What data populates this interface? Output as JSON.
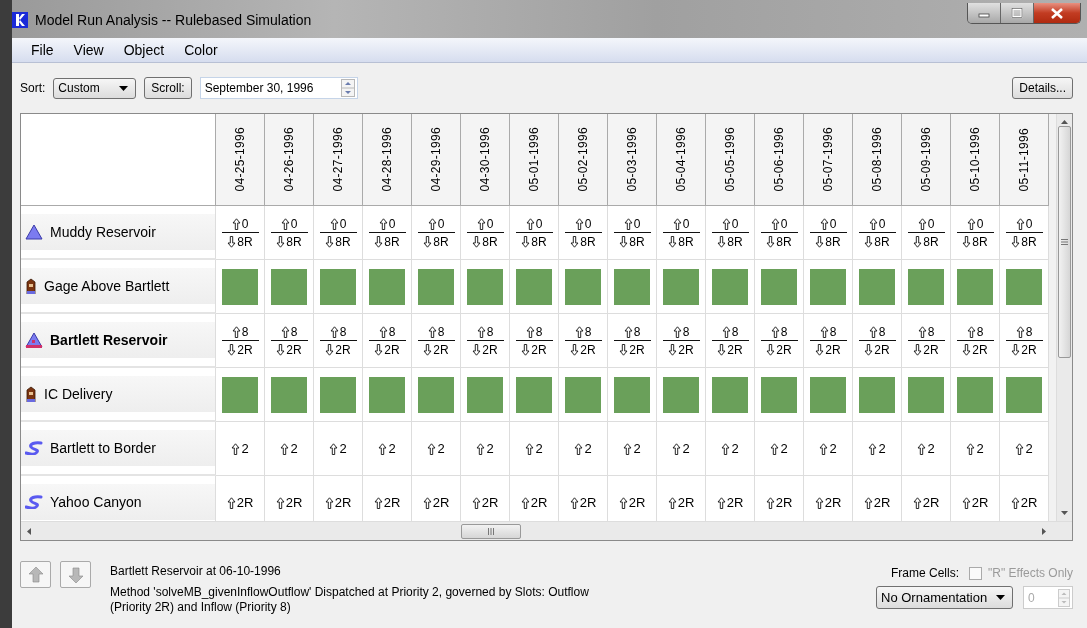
{
  "window": {
    "title": "Model Run Analysis -- Rulebased Simulation"
  },
  "menu": [
    "File",
    "View",
    "Object",
    "Color"
  ],
  "toolbar": {
    "sort_label": "Sort:",
    "sort_value": "Custom",
    "scroll_button": "Scroll:",
    "date": "September 30, 1996",
    "details_button": "Details..."
  },
  "table": {
    "columns": [
      "04-25-1996",
      "04-26-1996",
      "04-27-1996",
      "04-28-1996",
      "04-29-1996",
      "04-30-1996",
      "05-01-1996",
      "05-02-1996",
      "05-03-1996",
      "05-04-1996",
      "05-05-1996",
      "05-06-1996",
      "05-07-1996",
      "05-08-1996",
      "05-09-1996",
      "05-10-1996",
      "05-11-1996"
    ],
    "rows": [
      {
        "name": "Muddy Reservoir",
        "kind": "reservoir",
        "selected": false,
        "cells": [
          {
            "up": "0",
            "down": "8R"
          },
          {
            "up": "0",
            "down": "8R"
          },
          {
            "up": "0",
            "down": "8R"
          },
          {
            "up": "0",
            "down": "8R"
          },
          {
            "up": "0",
            "down": "8R"
          },
          {
            "up": "0",
            "down": "8R"
          },
          {
            "up": "0",
            "down": "8R"
          },
          {
            "up": "0",
            "down": "8R"
          },
          {
            "up": "0",
            "down": "8R"
          },
          {
            "up": "0",
            "down": "8R"
          },
          {
            "up": "0",
            "down": "8R"
          },
          {
            "up": "0",
            "down": "8R"
          },
          {
            "up": "0",
            "down": "8R"
          },
          {
            "up": "0",
            "down": "8R"
          },
          {
            "up": "0",
            "down": "8R"
          },
          {
            "up": "0",
            "down": "8R"
          },
          {
            "up": "0",
            "down": "8R"
          }
        ]
      },
      {
        "name": "Gage Above Bartlett",
        "kind": "gage",
        "selected": false,
        "cells": [
          {
            "filled": true
          },
          {
            "filled": true
          },
          {
            "filled": true
          },
          {
            "filled": true
          },
          {
            "filled": true
          },
          {
            "filled": true
          },
          {
            "filled": true
          },
          {
            "filled": true
          },
          {
            "filled": true
          },
          {
            "filled": true
          },
          {
            "filled": true
          },
          {
            "filled": true
          },
          {
            "filled": true
          },
          {
            "filled": true
          },
          {
            "filled": true
          },
          {
            "filled": true
          },
          {
            "filled": true
          }
        ]
      },
      {
        "name": "Bartlett Reservoir",
        "kind": "reservoir",
        "selected": true,
        "cells": [
          {
            "up": "8",
            "down": "2R"
          },
          {
            "up": "8",
            "down": "2R"
          },
          {
            "up": "8",
            "down": "2R"
          },
          {
            "up": "8",
            "down": "2R"
          },
          {
            "up": "8",
            "down": "2R"
          },
          {
            "up": "8",
            "down": "2R"
          },
          {
            "up": "8",
            "down": "2R"
          },
          {
            "up": "8",
            "down": "2R"
          },
          {
            "up": "8",
            "down": "2R"
          },
          {
            "up": "8",
            "down": "2R"
          },
          {
            "up": "8",
            "down": "2R"
          },
          {
            "up": "8",
            "down": "2R"
          },
          {
            "up": "8",
            "down": "2R"
          },
          {
            "up": "8",
            "down": "2R"
          },
          {
            "up": "8",
            "down": "2R"
          },
          {
            "up": "8",
            "down": "2R"
          },
          {
            "up": "8",
            "down": "2R"
          }
        ]
      },
      {
        "name": "IC Delivery",
        "kind": "gage",
        "selected": false,
        "cells": [
          {
            "filled": true
          },
          {
            "filled": true
          },
          {
            "filled": true
          },
          {
            "filled": true
          },
          {
            "filled": true
          },
          {
            "filled": true
          },
          {
            "filled": true
          },
          {
            "filled": true
          },
          {
            "filled": true
          },
          {
            "filled": true
          },
          {
            "filled": true
          },
          {
            "filled": true
          },
          {
            "filled": true
          },
          {
            "filled": true
          },
          {
            "filled": true
          },
          {
            "filled": true
          },
          {
            "filled": true
          }
        ]
      },
      {
        "name": "Bartlett to Border",
        "kind": "reach",
        "selected": false,
        "cells": [
          {
            "up": "2"
          },
          {
            "up": "2"
          },
          {
            "up": "2"
          },
          {
            "up": "2"
          },
          {
            "up": "2"
          },
          {
            "up": "2"
          },
          {
            "up": "2"
          },
          {
            "up": "2"
          },
          {
            "up": "2"
          },
          {
            "up": "2"
          },
          {
            "up": "2"
          },
          {
            "up": "2"
          },
          {
            "up": "2"
          },
          {
            "up": "2"
          },
          {
            "up": "2"
          },
          {
            "up": "2"
          },
          {
            "up": "2"
          }
        ]
      },
      {
        "name": "Yahoo Canyon",
        "kind": "reach",
        "selected": false,
        "cells": [
          {
            "up": "2R"
          },
          {
            "up": "2R"
          },
          {
            "up": "2R"
          },
          {
            "up": "2R"
          },
          {
            "up": "2R"
          },
          {
            "up": "2R"
          },
          {
            "up": "2R"
          },
          {
            "up": "2R"
          },
          {
            "up": "2R"
          },
          {
            "up": "2R"
          },
          {
            "up": "2R"
          },
          {
            "up": "2R"
          },
          {
            "up": "2R"
          },
          {
            "up": "2R"
          },
          {
            "up": "2R"
          },
          {
            "up": "2R"
          },
          {
            "up": "2R"
          }
        ]
      }
    ]
  },
  "footer": {
    "nav_buttons": [
      {
        "kind": "up",
        "disabled": true
      },
      {
        "kind": "down",
        "disabled": true
      }
    ],
    "detail_title": "Bartlett Reservoir at 06-10-1996",
    "detail_text": "Method 'solveMB_givenInflowOutflow' Dispatched at Priority 2, governed by Slots: Outflow (Priority 2R) and Inflow (Priority 8)",
    "frame_cells_label": "Frame Cells:",
    "r_effects": {
      "label": "\"R\" Effects Only",
      "checked": false,
      "disabled": true
    },
    "ornamentation": "No Ornamentation",
    "count": {
      "value": "0",
      "disabled": true
    }
  }
}
